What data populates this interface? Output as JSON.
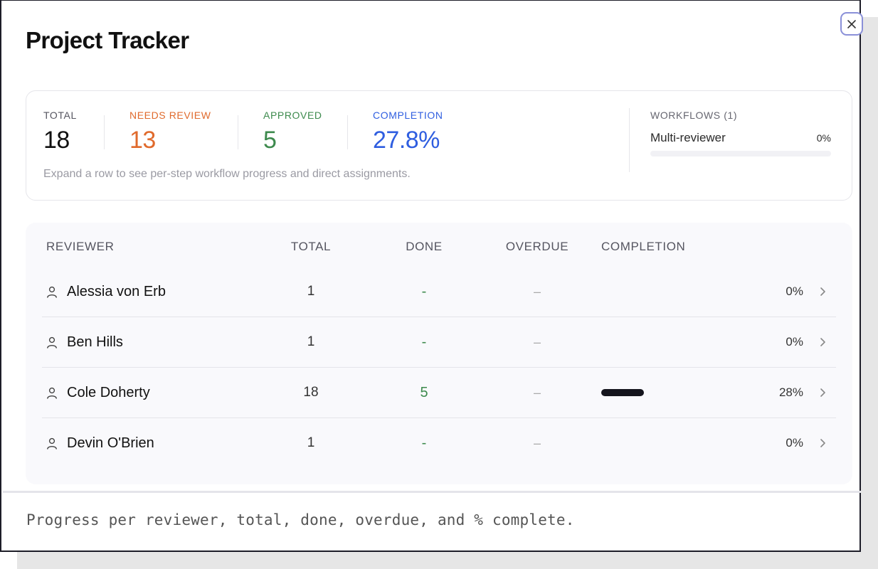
{
  "modal": {
    "title": "Project Tracker"
  },
  "summary": {
    "stats": [
      {
        "label": "TOTAL",
        "value": "18",
        "color": "#111111",
        "label_color": "#555560"
      },
      {
        "label": "NEEDS REVIEW",
        "value": "13",
        "color": "#e06a2c",
        "label_color": "#e06a2c"
      },
      {
        "label": "APPROVED",
        "value": "5",
        "color": "#3d8a4d",
        "label_color": "#3d8a4d"
      },
      {
        "label": "COMPLETION",
        "value": "27.8%",
        "color": "#2f5ee0",
        "label_color": "#2f5ee0"
      }
    ],
    "hint": "Expand a row to see per-step workflow progress and direct assignments.",
    "workflows": {
      "label": "WORKFLOWS (1)",
      "items": [
        {
          "name": "Multi-reviewer",
          "percent_text": "0%",
          "progress": 0
        }
      ]
    }
  },
  "table": {
    "headers": {
      "reviewer": "REVIEWER",
      "total": "TOTAL",
      "done": "DONE",
      "overdue": "OVERDUE",
      "completion": "COMPLETION"
    },
    "rows": [
      {
        "name": "Alessia von Erb",
        "total": "1",
        "done": "-",
        "overdue": "–",
        "progress": 0,
        "percent": "0%"
      },
      {
        "name": "Ben Hills",
        "total": "1",
        "done": "-",
        "overdue": "–",
        "progress": 0,
        "percent": "0%"
      },
      {
        "name": "Cole Doherty",
        "total": "18",
        "done": "5",
        "overdue": "–",
        "progress": 0.28,
        "percent": "28%"
      },
      {
        "name": "Devin O'Brien",
        "total": "1",
        "done": "-",
        "overdue": "–",
        "progress": 0,
        "percent": "0%"
      }
    ]
  },
  "caption": "Progress per reviewer, total, done, overdue, and % complete.",
  "icons": {
    "close": "close-icon",
    "person": "person-icon",
    "chevron": "chevron-right-icon"
  },
  "colors": {
    "accent_focus": "#8a90d8",
    "bar_fill": "#15151d"
  }
}
